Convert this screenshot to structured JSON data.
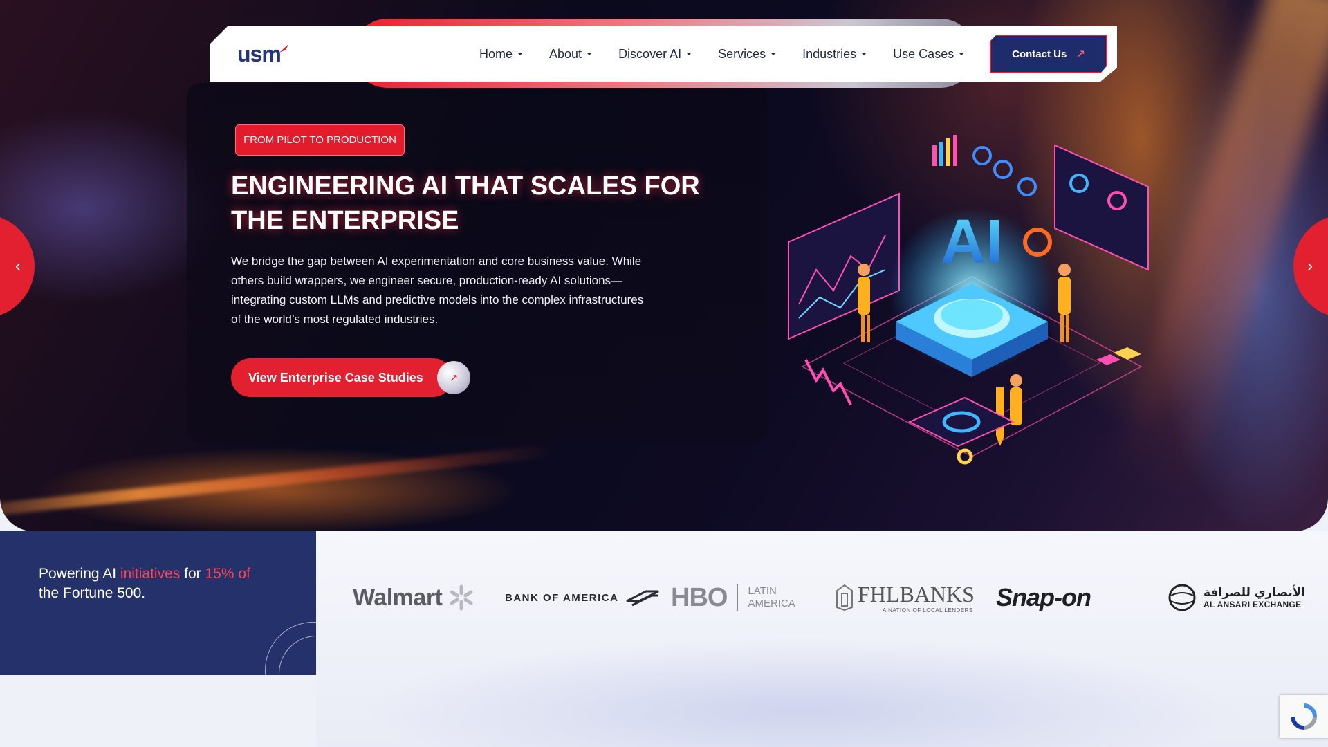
{
  "brand": {
    "logo_text": "usm"
  },
  "nav": {
    "items": [
      {
        "label": "Home"
      },
      {
        "label": "About"
      },
      {
        "label": "Discover AI"
      },
      {
        "label": "Services"
      },
      {
        "label": "Industries"
      },
      {
        "label": "Use Cases"
      }
    ],
    "contact_label": "Contact Us"
  },
  "hero": {
    "badge": "FROM PILOT TO PRODUCTION",
    "headline": "ENGINEERING AI THAT SCALES FOR THE ENTERPRISE",
    "subtext": "We bridge the gap between AI experimentation and core business value. While others build wrappers, we engineer secure, production-ready AI solutions—integrating custom LLMs and predictive models into the complex infrastructures of the world’s most regulated industries.",
    "cta_label": "View Enterprise Case Studies",
    "illustration_text": "AI"
  },
  "stats": {
    "part1": "Powering AI ",
    "highlight1": "initiatives",
    "part2": " for ",
    "highlight2": "15% of",
    "part3": " the Fortune 500."
  },
  "clients": {
    "walmart": "Walmart",
    "boa": "BANK OF AMERICA",
    "hbo": "HBO",
    "hbo_sub1": "LATIN",
    "hbo_sub2": "AMERICA",
    "fhl": "FHLBANKS",
    "fhl_sub": "A NATION OF LOCAL LENDERS",
    "snap": "Snap-on",
    "ansari_ar": "الأنصاري للصرافة",
    "ansari_en": "AL ANSARI EXCHANGE"
  },
  "colors": {
    "accent": "#e3202f",
    "navy": "#24316b"
  }
}
